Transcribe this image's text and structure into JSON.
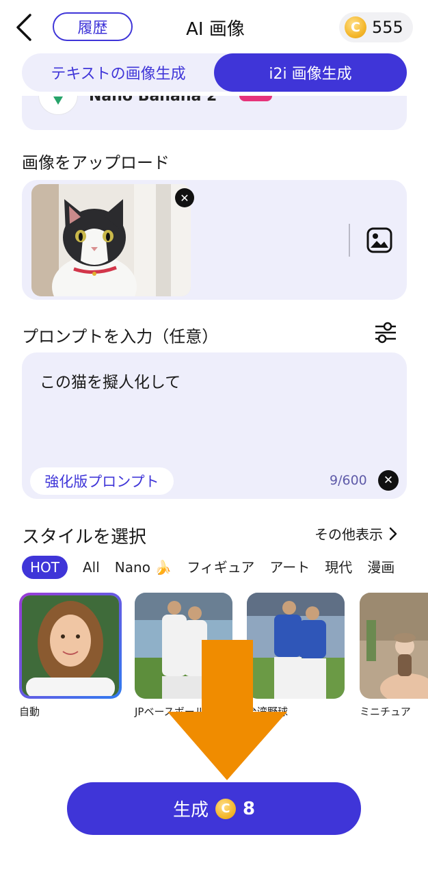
{
  "header": {
    "back_icon": "chevron-left-icon",
    "history_label": "履歴",
    "title": "AI 画像",
    "coin_symbol": "C",
    "coin_count": "555"
  },
  "mode_tabs": [
    {
      "label": "テキストの画像生成",
      "active": false
    },
    {
      "label": "i2i 画像生成",
      "active": true
    }
  ],
  "upload": {
    "title": "画像をアップロード",
    "remove_symbol": "✕",
    "gallery_icon": "image-icon"
  },
  "prompt": {
    "title": "プロンプトを入力（任意）",
    "text": "この猫を擬人化して",
    "enhance_label": "強化版プロンプト",
    "char_count": "9/600",
    "clear_symbol": "✕"
  },
  "styles": {
    "title": "スタイルを選択",
    "more_label": "その他表示",
    "chips": [
      "HOT",
      "All",
      "Nano 🍌",
      "フィギュア",
      "アート",
      "現代",
      "漫画"
    ],
    "active_chip": "HOT",
    "cards": [
      {
        "label": "自動",
        "selected": true
      },
      {
        "label": "JPベースボール",
        "selected": false
      },
      {
        "label": "台湾野球",
        "selected": false
      },
      {
        "label": "ミニチュア",
        "selected": false
      }
    ]
  },
  "generate": {
    "label": "生成",
    "coin_symbol": "C",
    "cost": "8"
  },
  "colors": {
    "accent": "#3f35d8",
    "panel": "#eeeefb",
    "coin": "#f4b72c",
    "arrow": "#f08c00"
  }
}
